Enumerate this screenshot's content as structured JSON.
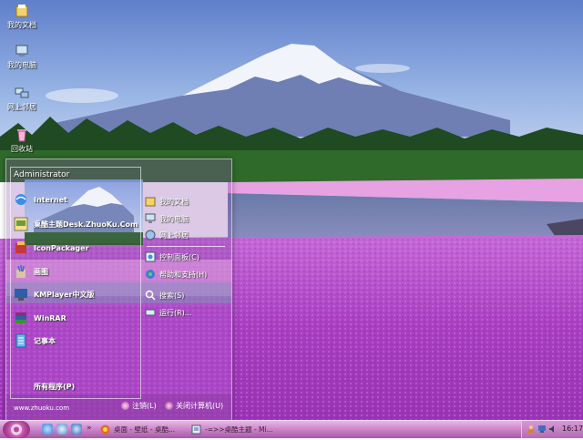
{
  "desktop": {
    "icons": [
      {
        "label": "我的文档",
        "icon": "my-documents-icon"
      },
      {
        "label": "我的电脑",
        "icon": "my-computer-icon"
      },
      {
        "label": "网上邻居",
        "icon": "network-places-icon"
      },
      {
        "label": "回收站",
        "icon": "recycle-bin-icon"
      }
    ]
  },
  "start_menu": {
    "user": "Administrator",
    "programs": [
      {
        "label": "Internet",
        "icon": "internet-explorer-icon"
      },
      {
        "label": "桌酷主题Desk.ZhuoKu.Com",
        "icon": "zhuoku-theme-icon"
      },
      {
        "label": "IconPackager",
        "icon": "iconpackager-icon"
      },
      {
        "label": "画图",
        "icon": "paint-icon"
      },
      {
        "label": "KMPlayer中文版",
        "icon": "kmplayer-icon"
      },
      {
        "label": "WinRAR",
        "icon": "winrar-icon"
      },
      {
        "label": "记事本",
        "icon": "notepad-icon"
      }
    ],
    "all_programs": "所有程序(P)",
    "places": [
      {
        "label": "我的文档",
        "icon": "my-documents-icon"
      },
      {
        "label": "我的电脑",
        "icon": "my-computer-icon"
      },
      {
        "label": "网上邻居",
        "icon": "network-places-icon"
      },
      {
        "label": "控制面板(C)",
        "icon": "control-panel-icon"
      },
      {
        "label": "帮助和支持(H)",
        "icon": "help-icon"
      },
      {
        "label": "搜索(S)",
        "icon": "search-icon"
      },
      {
        "label": "运行(R)...",
        "icon": "run-icon"
      }
    ],
    "website": "www.zhuoku.com",
    "logoff": "注销(L)",
    "shutdown": "关闭计算机(U)"
  },
  "taskbar": {
    "tasks": [
      {
        "label": "桌面 - 壁纸 - 桌酷...",
        "icon": "browser-icon"
      },
      {
        "label": "-=>>桌酷主题 - Mi...",
        "icon": "editor-icon"
      }
    ],
    "clock": "16:17"
  },
  "colors": {
    "sky": "#8fb4e6",
    "flowers": "#b53fcf",
    "taskbar": "#c77fc6",
    "menu_tint": "#7a3c96"
  }
}
